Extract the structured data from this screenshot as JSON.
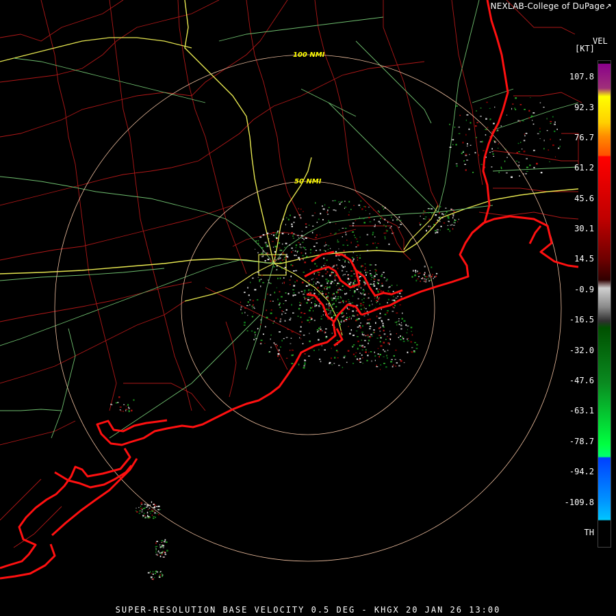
{
  "credit": "NEXLAB-College of DuPage",
  "credit_icon": "external-link-icon",
  "range_rings": [
    "100 NMI",
    "50 NMI"
  ],
  "legend": {
    "title": "VEL",
    "unit": "[KT]",
    "labels": [
      "107.8",
      "92.3",
      "76.7",
      "61.2",
      "45.6",
      "30.1",
      "14.5",
      "-0.9",
      "-16.5",
      "-32.0",
      "-47.6",
      "-63.1",
      "-78.7",
      "-94.2",
      "-109.8",
      "TH"
    ],
    "colors": {
      "purple": "#8a008a",
      "yellow": "#ffff00",
      "orange": "#ff8c00",
      "red": "#ff0000",
      "dark_red": "#6e0000",
      "gray": "#888888",
      "dark_green": "#005000",
      "green": "#00ff40",
      "blue": "#0040ff",
      "cyan": "#00c0ff"
    }
  },
  "caption": "SUPER-RESOLUTION BASE VELOCITY 0.5 DEG - KHGX 20 JAN 26 13:00",
  "map_colors": {
    "county_lines": "#b01818",
    "coastline": "#ff1010",
    "highways": "#e6e650",
    "roads": "#6fbf6f",
    "range_ring": "#f0c0a0"
  }
}
